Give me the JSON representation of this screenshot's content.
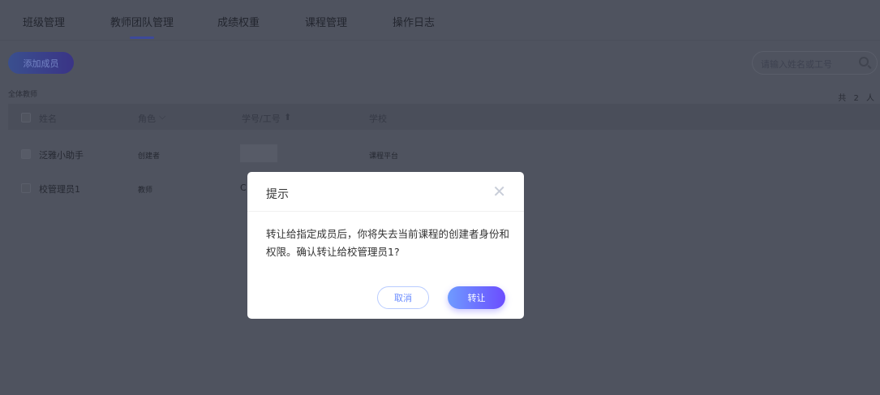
{
  "tabs": [
    "班级管理",
    "教师团队管理",
    "成绩权重",
    "课程管理",
    "操作日志"
  ],
  "add_button": "添加成员",
  "search_placeholder": "请输入姓名或工号",
  "section_label": "全体教师",
  "count": "共 2 人",
  "columns": {
    "name": "姓名",
    "role": "角色",
    "id": "学号/工号",
    "school": "学校"
  },
  "rows": [
    {
      "name": "泛雅小助手",
      "role": "创建者",
      "id": "",
      "school": "课程平台"
    },
    {
      "name": "校管理员1",
      "role": "教师",
      "id": "C",
      "school": ""
    }
  ],
  "dialog": {
    "title": "提示",
    "message": "转让给指定成员后，你将失去当前课程的创建者身份和权限。确认转让给校管理员1?",
    "cancel": "取消",
    "confirm": "转让"
  }
}
